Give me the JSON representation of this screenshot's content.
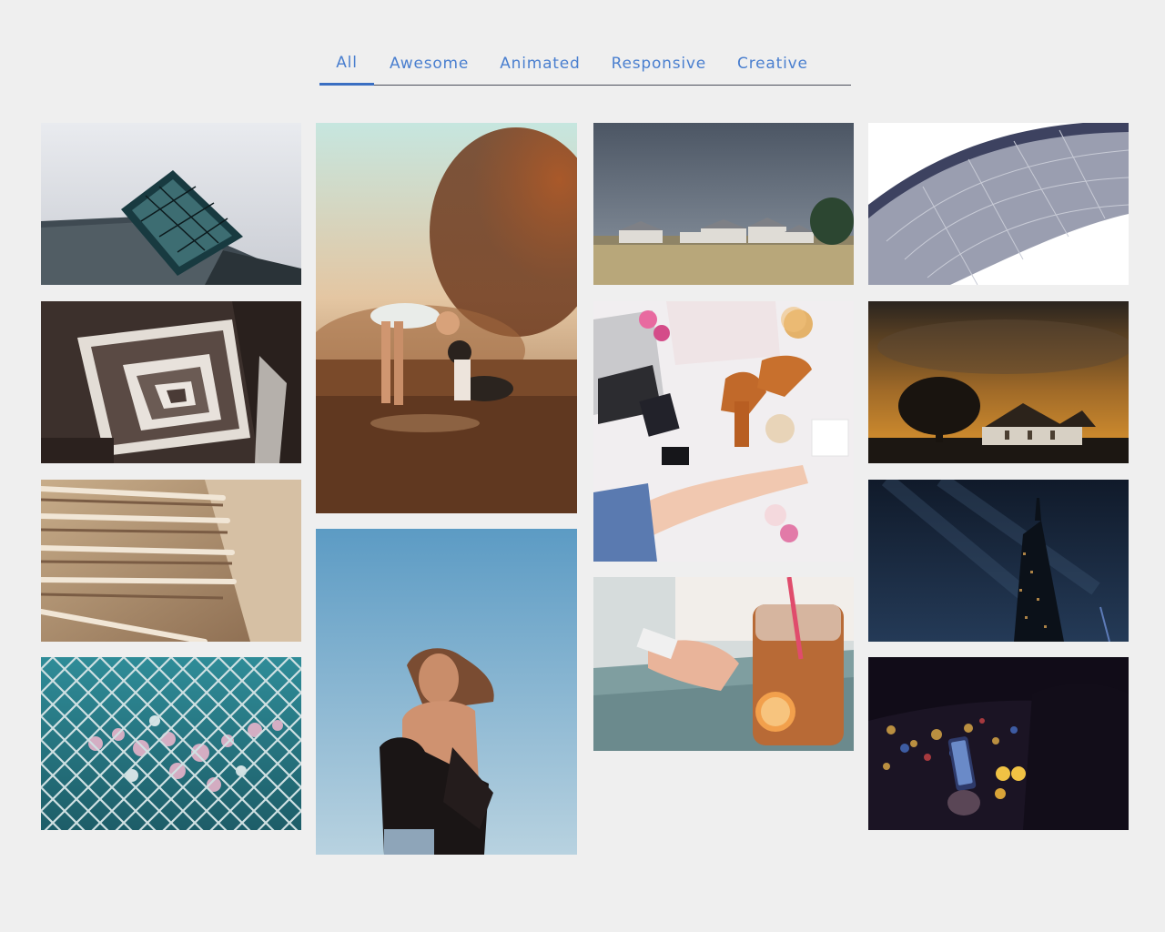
{
  "filters": {
    "tabs": [
      {
        "label": "All",
        "active": true
      },
      {
        "label": "Awesome",
        "active": false
      },
      {
        "label": "Animated",
        "active": false
      },
      {
        "label": "Responsive",
        "active": false
      },
      {
        "label": "Creative",
        "active": false
      }
    ]
  },
  "colors": {
    "accent": "#4a7fcf",
    "background": "#efefef"
  },
  "gallery": {
    "items": [
      {
        "subject": "glass-pyramid-architecture"
      },
      {
        "subject": "spiral-staircase"
      },
      {
        "subject": "beige-ceiling-slats"
      },
      {
        "subject": "chain-link-fence-bokeh"
      },
      {
        "subject": "girl-with-dog-at-sunset"
      },
      {
        "subject": "woman-in-black-fur-against-sky"
      },
      {
        "subject": "farmhouses-in-field"
      },
      {
        "subject": "flatlay-laptop-and-sandals"
      },
      {
        "subject": "phone-and-iced-tea-jar"
      },
      {
        "subject": "curved-white-building"
      },
      {
        "subject": "church-and-tree-at-dusk"
      },
      {
        "subject": "skyscraper-at-night"
      },
      {
        "subject": "phone-in-car-city-lights"
      }
    ]
  }
}
